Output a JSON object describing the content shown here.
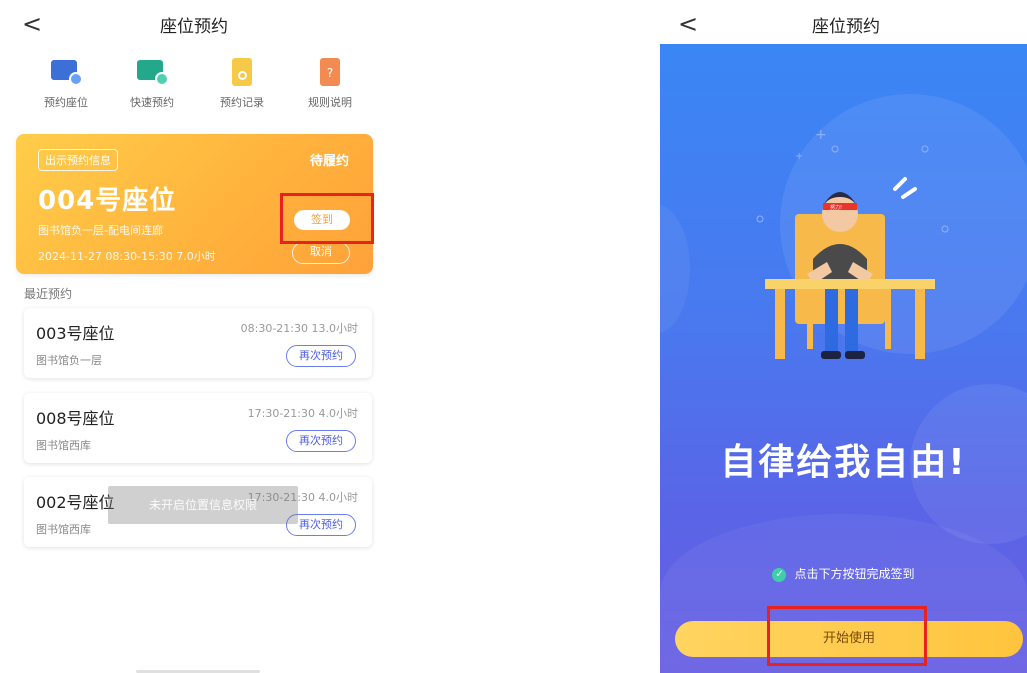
{
  "left": {
    "header": {
      "back": "<",
      "title": "座位预约"
    },
    "quick_actions": [
      {
        "label": "预约座位",
        "icon": "calendar-seat-icon"
      },
      {
        "label": "快速预约",
        "icon": "quick-seat-icon"
      },
      {
        "label": "预约记录",
        "icon": "record-icon"
      },
      {
        "label": "规则说明",
        "icon": "rules-icon"
      }
    ],
    "current": {
      "tag": "出示预约信息",
      "status": "待履约",
      "seat": "004号座位",
      "location": "图书馆负一层-配电间连廊",
      "time": "2024-11-27  08:30-15:30  7.0小时",
      "checkin": "签到",
      "cancel": "取消"
    },
    "recent_label": "最近预约",
    "recent": [
      {
        "seat": "003号座位",
        "time": "08:30-21:30  13.0小时",
        "location": "图书馆负一层",
        "action": "再次预约"
      },
      {
        "seat": "008号座位",
        "time": "17:30-21:30  4.0小时",
        "location": "图书馆西库",
        "action": "再次预约"
      },
      {
        "seat": "002号座位",
        "time": "17:30-21:30  4.0小时",
        "location": "图书馆西库",
        "action": "再次预约"
      }
    ],
    "toast": "未开启位置信息权限"
  },
  "right": {
    "header": {
      "back": "<",
      "title": "座位预约"
    },
    "headband": "努力!",
    "slogan": "自律给我自由!",
    "hint": "点击下方按钮完成签到",
    "start_button": "开始使用"
  },
  "colors": {
    "accent_orange": "#ffb23c",
    "accent_blue": "#4a78ef",
    "highlight_red": "#e8231d"
  }
}
